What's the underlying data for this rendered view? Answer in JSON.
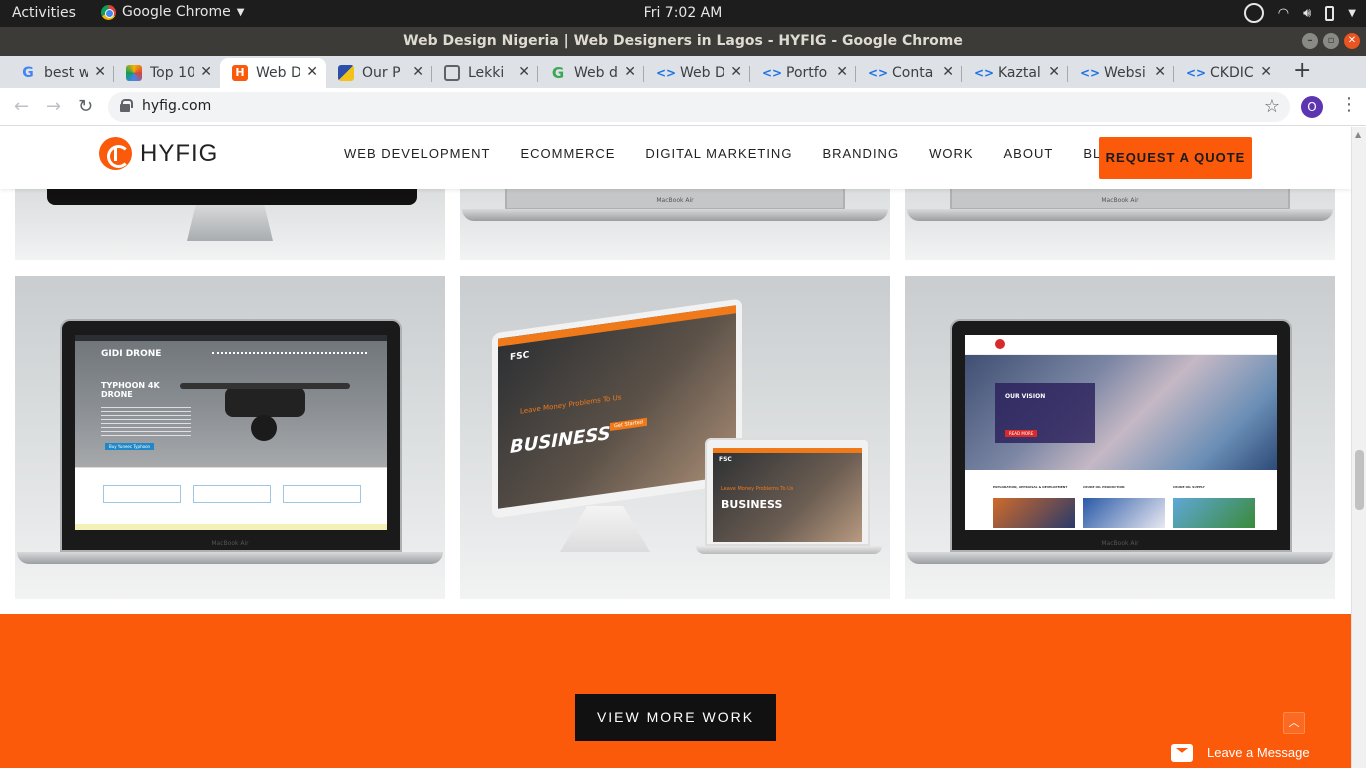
{
  "os": {
    "activities": "Activities",
    "app_name": "Google Chrome",
    "clock": "Fri  7:02 AM"
  },
  "window": {
    "title": "Web Design Nigeria | Web Designers in Lagos - HYFIG - Google Chrome"
  },
  "tabs": [
    {
      "label": "best w",
      "icon": "google-icon"
    },
    {
      "label": "Top 10",
      "icon": "top10-icon"
    },
    {
      "label": "Web D",
      "icon": "hyfig-icon"
    },
    {
      "label": "Our P",
      "icon": "ourp-icon"
    },
    {
      "label": "Lekki",
      "icon": "globe-icon"
    },
    {
      "label": "Web d",
      "icon": "grammarly-icon"
    },
    {
      "label": "Web D",
      "icon": "code-icon"
    },
    {
      "label": "Portfo",
      "icon": "code-icon"
    },
    {
      "label": "Conta",
      "icon": "code-icon"
    },
    {
      "label": "Kaztal",
      "icon": "code-icon"
    },
    {
      "label": "Websi",
      "icon": "code-icon"
    },
    {
      "label": "CKDIC",
      "icon": "code-icon"
    }
  ],
  "browser": {
    "url": "hyfig.com",
    "profile_initial": "O"
  },
  "site": {
    "logo_text": "HYFIG",
    "nav": [
      "WEB DEVELOPMENT",
      "ECOMMERCE",
      "DIGITAL MARKETING",
      "BRANDING",
      "WORK",
      "ABOUT",
      "BLOG"
    ],
    "cta": "REQUEST A QUOTE",
    "view_more": "VIEW MORE WORK",
    "live_chat": "Leave a Message",
    "laptop_brand": "MacBook Air"
  },
  "portfolio": {
    "gidi": {
      "logo": "GIDI DRONE",
      "headline": "TYPHOON 4K DRONE",
      "button": "Buy Yuneec Typhoon"
    },
    "fsc": {
      "logo": "FSC",
      "tagline": "Leave Money Problems To Us",
      "headline": "BUSINESS",
      "button": "Get Started"
    },
    "oil": {
      "heading": "OUR VISION",
      "button": "READ MORE",
      "col1": "EXPLORATION, APPRAISAL & DEVELOPMENT",
      "col2": "CRUDE OIL PRODUCTION",
      "col3": "CRUDE OIL SUPPLY"
    }
  },
  "colors": {
    "brand_orange": "#fa5a0a",
    "dark": "#111111"
  }
}
